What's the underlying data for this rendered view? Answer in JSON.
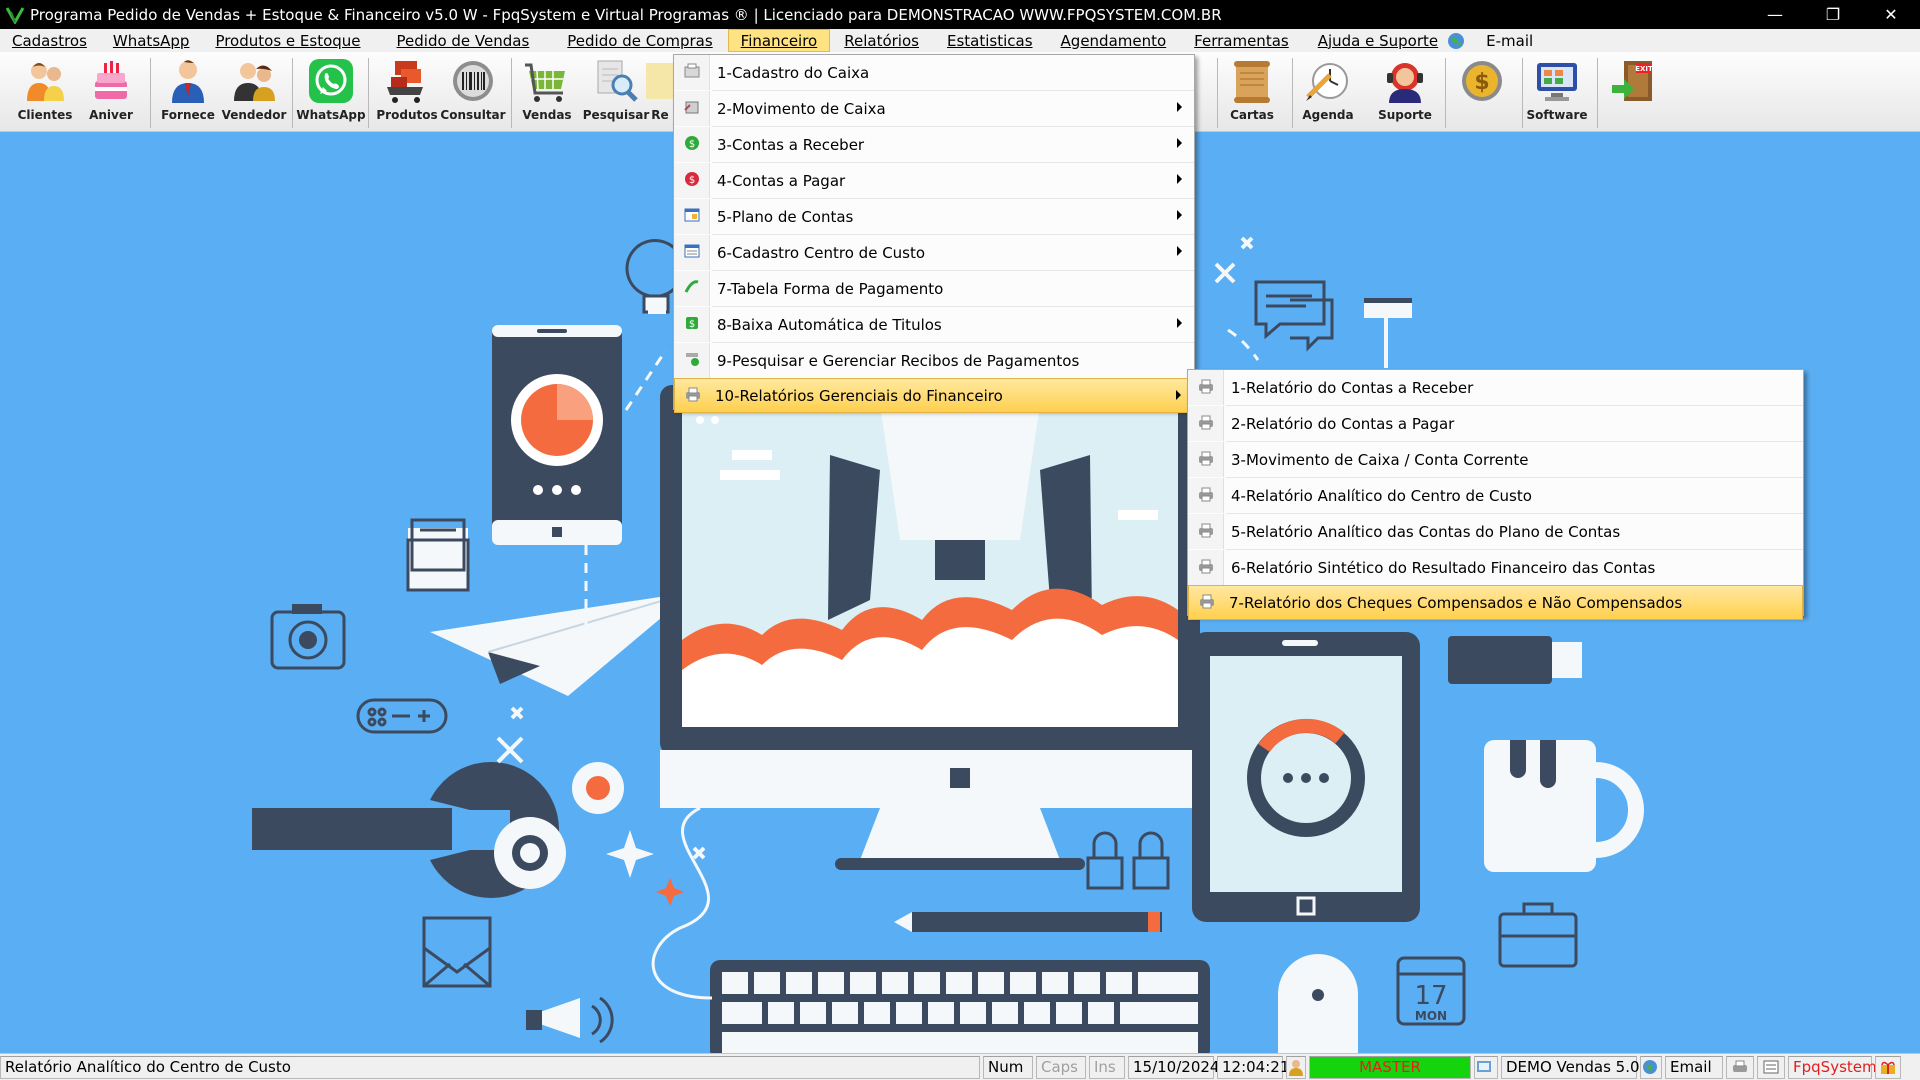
{
  "titlebar": {
    "title": "Programa Pedido de Vendas + Estoque & Financeiro v5.0 W - FpqSystem e Virtual Programas ® | Licenciado para  DEMONSTRACAO WWW.FPQSYSTEM.COM.BR",
    "minimize": "—",
    "restore": "❐",
    "close": "✕"
  },
  "menubar": {
    "items": [
      {
        "label": "Cadastros"
      },
      {
        "label": "WhatsApp"
      },
      {
        "label": "Produtos e Estoque"
      },
      {
        "label": "Pedido de Vendas"
      },
      {
        "label": "Pedido de Compras"
      },
      {
        "label": "Financeiro"
      },
      {
        "label": "Relatórios"
      },
      {
        "label": "Estatisticas"
      },
      {
        "label": "Agendamento"
      },
      {
        "label": "Ferramentas"
      },
      {
        "label": "Ajuda e Suporte"
      },
      {
        "label": "E-mail"
      }
    ],
    "active_index": 5
  },
  "toolbar": {
    "buttons": [
      {
        "label": "Clientes",
        "icon": "clients-icon"
      },
      {
        "label": "Aniver",
        "icon": "birthday-cake-icon"
      },
      {
        "label": "Fornece",
        "icon": "supplier-icon"
      },
      {
        "label": "Vendedor",
        "icon": "salesperson-icon"
      },
      {
        "label": "WhatsApp",
        "icon": "whatsapp-icon"
      },
      {
        "label": "Produtos",
        "icon": "products-cart-icon"
      },
      {
        "label": "Consultar",
        "icon": "barcode-icon"
      },
      {
        "label": "Vendas",
        "icon": "sales-cart-icon"
      },
      {
        "label": "Pesquisar",
        "icon": "search-icon"
      },
      {
        "label": "Re",
        "icon": "report-icon"
      },
      {
        "label": "Cartas",
        "icon": "letters-icon"
      },
      {
        "label": "Agenda",
        "icon": "agenda-icon"
      },
      {
        "label": "Suporte",
        "icon": "support-icon"
      },
      {
        "label": "",
        "icon": "money-icon"
      },
      {
        "label": "Software",
        "icon": "software-icon"
      },
      {
        "label": "",
        "icon": "exit-icon"
      }
    ]
  },
  "financeiro_menu": {
    "items": [
      {
        "label": "1-Cadastro do Caixa",
        "submenu": false
      },
      {
        "label": "2-Movimento de Caixa",
        "submenu": true
      },
      {
        "label": "3-Contas a Receber",
        "submenu": true
      },
      {
        "label": "4-Contas a Pagar",
        "submenu": true
      },
      {
        "label": "5-Plano de Contas",
        "submenu": true
      },
      {
        "label": "6-Cadastro Centro de Custo",
        "submenu": true
      },
      {
        "label": "7-Tabela Forma de Pagamento",
        "submenu": false
      },
      {
        "label": "8-Baixa Automática de Titulos",
        "submenu": true
      },
      {
        "label": "9-Pesquisar e Gerenciar Recibos de Pagamentos",
        "submenu": false
      },
      {
        "label": "10-Relatórios Gerenciais do Financeiro",
        "submenu": true
      }
    ],
    "highlighted_index": 9
  },
  "relatorios_submenu": {
    "items": [
      {
        "label": "1-Relatório do Contas a Receber"
      },
      {
        "label": "2-Relatório do Contas a Pagar"
      },
      {
        "label": "3-Movimento de Caixa / Conta Corrente"
      },
      {
        "label": "4-Relatório Analítico do Centro de Custo"
      },
      {
        "label": "5-Relatório Analítico das Contas do Plano de Contas"
      },
      {
        "label": "6-Relatório Sintético do Resultado Financeiro das Contas"
      },
      {
        "label": "7-Relatório dos Cheques Compensados e Não Compensados"
      }
    ],
    "highlighted_index": 6
  },
  "desktop": {
    "calendar_day": "17",
    "calendar_weekday": "MON"
  },
  "statusbar": {
    "hint": "Relatório Analítico do Centro de Custo",
    "num": "Num",
    "caps": "Caps",
    "ins": "Ins",
    "date": "15/10/2024",
    "time": "12:04:21",
    "user": "MASTER",
    "version": "DEMO Vendas 5.0",
    "email": "Email",
    "brand": "FpqSystem"
  },
  "colors": {
    "desktop_bg": "#5aaef3",
    "highlight": "#ffd04e",
    "accent_orange": "#f36b3f",
    "dark_slate": "#3c4a5f"
  }
}
